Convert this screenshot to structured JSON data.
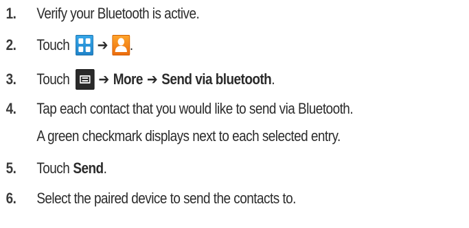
{
  "steps": [
    {
      "number": "1.",
      "text": "Verify your Bluetooth is active."
    },
    {
      "number": "2.",
      "prefix": "Touch",
      "arrow": "➔",
      "suffix": ".",
      "icons": [
        "apps-icon",
        "contacts-icon"
      ]
    },
    {
      "number": "3.",
      "prefix": "Touch",
      "icon": "menu-icon",
      "arrow": "➔",
      "more": "More",
      "send_via": "Send via bluetooth",
      "suffix": "."
    },
    {
      "number": "4.",
      "text_line1": "Tap each contact that you would like to send via Bluetooth.",
      "text_line2": "A green checkmark displays next to each selected entry."
    },
    {
      "number": "5.",
      "prefix": "Touch",
      "bold": "Send",
      "suffix": "."
    },
    {
      "number": "6.",
      "text": "Select the paired device to send the contacts to."
    }
  ],
  "colors": {
    "text": "#2b2b2b",
    "apps_icon": "#1f83c9",
    "contacts_icon": "#ea6b0d",
    "menu_icon": "#2a2a2a"
  }
}
